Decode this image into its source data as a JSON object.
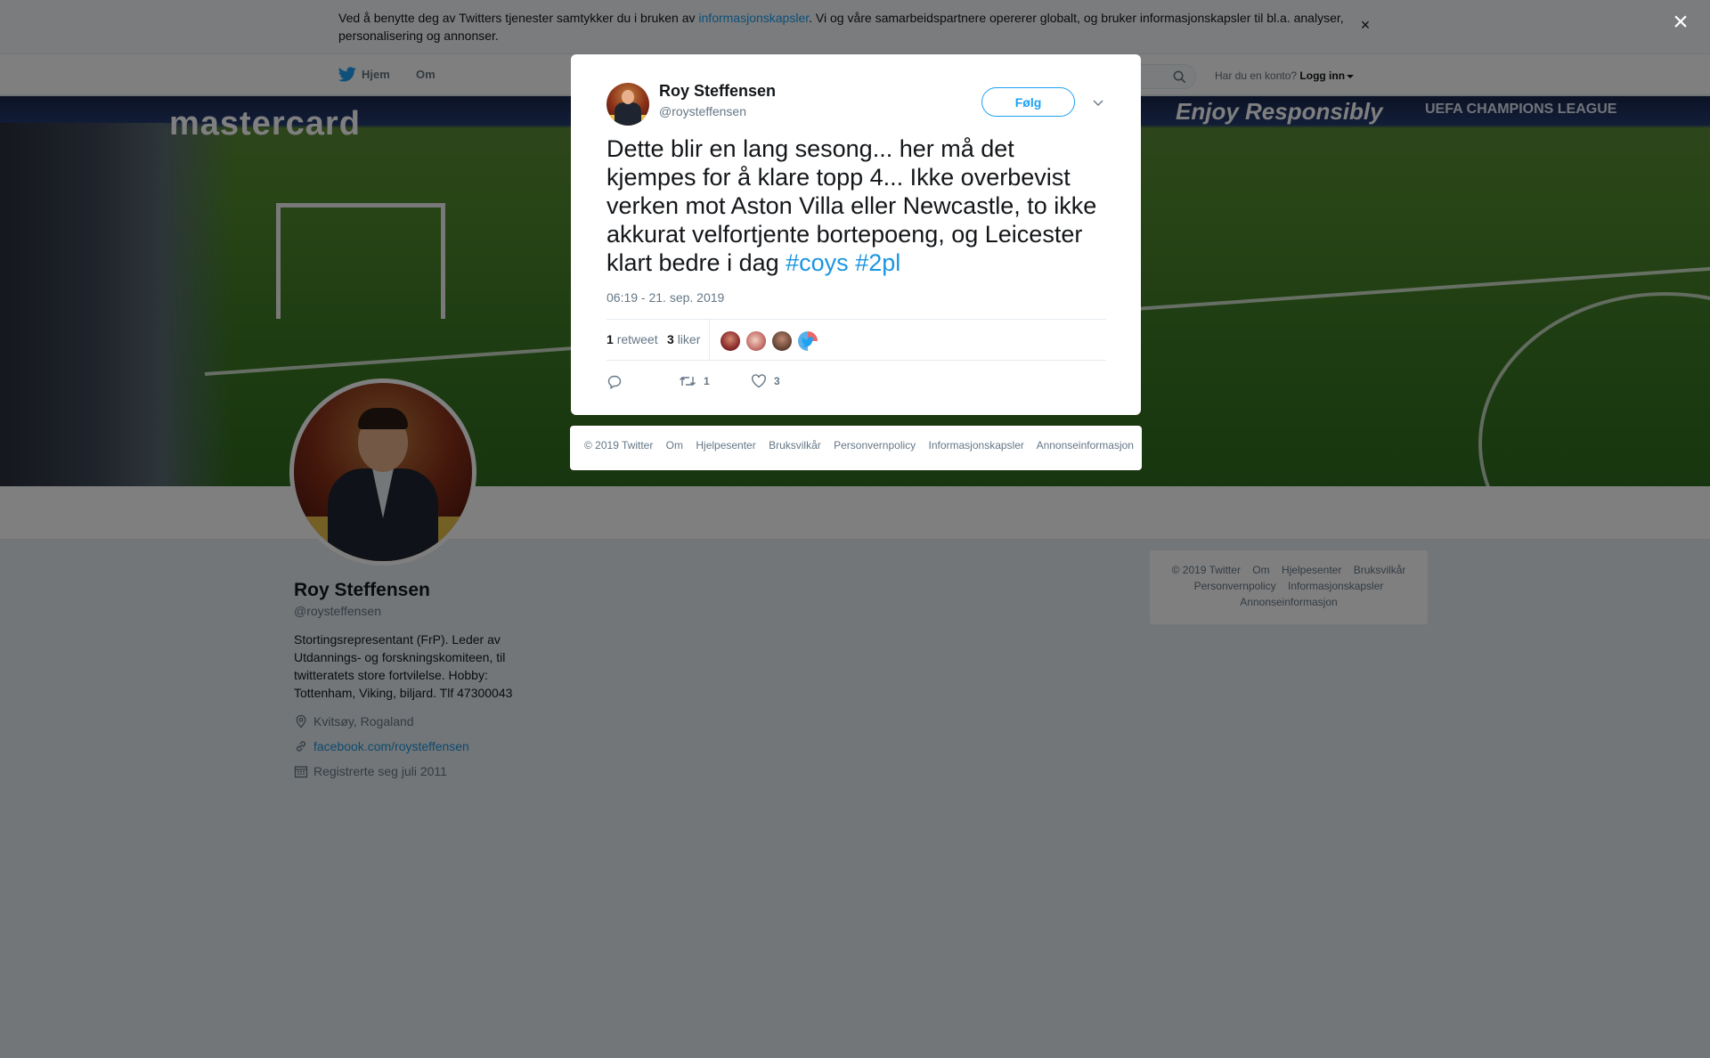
{
  "cookie_bar": {
    "text_before": "Ved å benytte deg av Twitters tjenester samtykker du i bruken av ",
    "link": "informasjonskapsler",
    "text_after": ". Vi og våre samarbeidspartnere opererer globalt, og bruker informasjonskapsler til bl.a. analyser, personalisering og annonser.",
    "close": "×"
  },
  "nav": {
    "home": "Hjem",
    "about": "Om",
    "account_prompt": "Har du en konto?",
    "login": "Logg inn"
  },
  "banner": {
    "ad_left": "mastercard",
    "ad_right": "Enjoy Responsibly",
    "ad_far_right": "UEFA CHAMPIONS LEAGUE"
  },
  "profile": {
    "name": "Roy Steffensen",
    "handle": "@roysteffensen",
    "bio": "Stortingsrepresentant (FrP). Leder av Utdannings- og forskningskomiteen, til twitteratets store fortvilelse. Hobby: Tottenham, Viking, biljard. Tlf 47300043",
    "location": "Kvitsøy, Rogaland",
    "link": "facebook.com/roysteffensen",
    "joined": "Registrerte seg juli 2011"
  },
  "side_footer": {
    "items": [
      "© 2019 Twitter",
      "Om",
      "Hjelpesenter",
      "Bruksvilkår",
      "Personvernpolicy",
      "Informasjonskapsler",
      "Annonseinformasjon"
    ]
  },
  "overlay": {
    "close": "×"
  },
  "tweet": {
    "author_name": "Roy Steffensen",
    "author_handle": "@roysteffensen",
    "follow_label": "Følg",
    "text": "Dette blir en lang sesong... her må det kjempes  for å klare topp 4... Ikke overbevist verken mot Aston Villa eller Newcastle, to ikke akkurat velfortjente bortepoeng, og Leicester klart bedre i dag ",
    "hashtag1": "#coys",
    "hashtag2": "#2pl",
    "timestamp": "06:19 - 21. sep. 2019",
    "retweets_count": "1",
    "retweets_label": "retweet",
    "likes_count": "3",
    "likes_label": "liker",
    "action_retweets": "1",
    "action_likes": "3"
  },
  "modal_footer": {
    "items": [
      "© 2019 Twitter",
      "Om",
      "Hjelpesenter",
      "Bruksvilkår",
      "Personvernpolicy",
      "Informasjonskapsler",
      "Annonseinformasjon"
    ]
  },
  "colors": {
    "accent": "#1da1f2",
    "link": "#1b95e0",
    "muted": "#657786"
  },
  "icons": [
    "twitter-bird-icon",
    "search-icon",
    "caret-down-icon",
    "close-icon",
    "location-icon",
    "link-icon",
    "calendar-icon",
    "chevron-down-icon",
    "reply-icon",
    "retweet-icon",
    "heart-icon"
  ]
}
